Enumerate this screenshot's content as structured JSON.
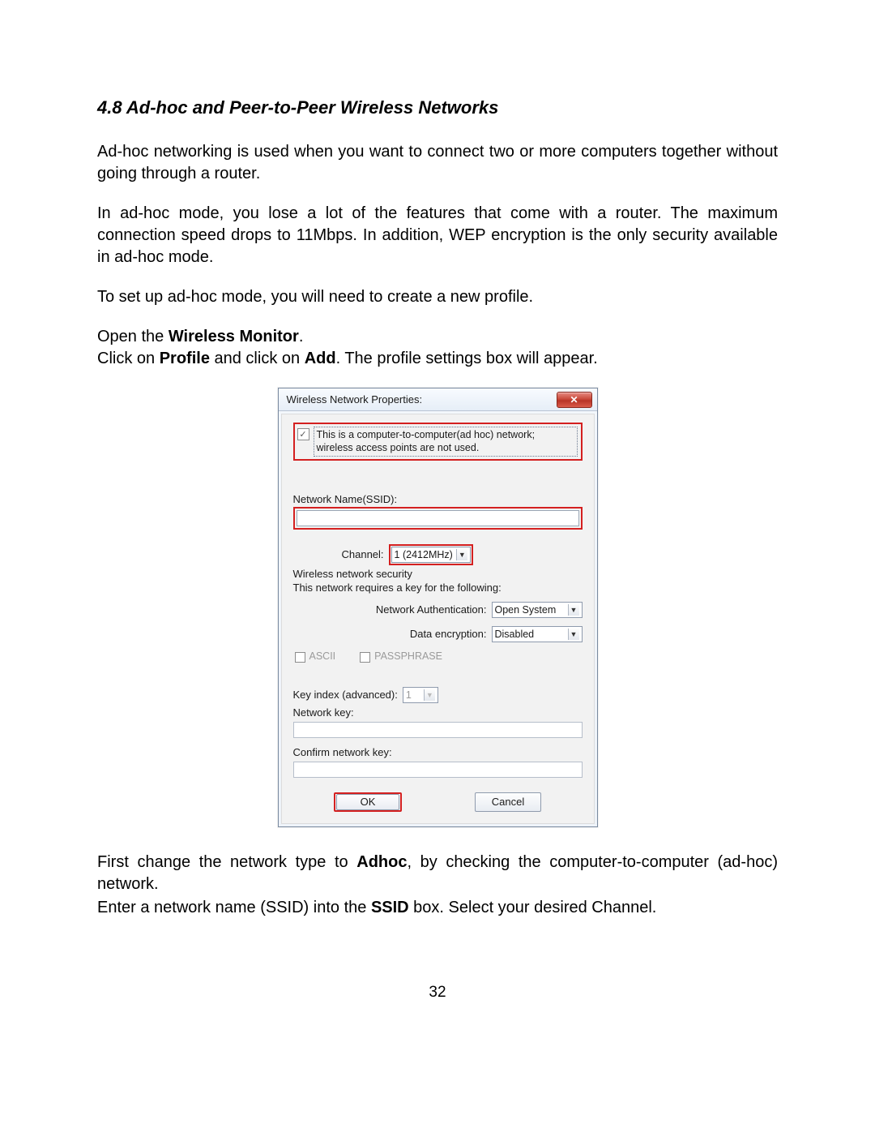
{
  "heading": "4.8 Ad-hoc and Peer-to-Peer Wireless Networks",
  "p1": "Ad-hoc networking is used when you want to connect two or more computers together without going through a router.",
  "p2": "In ad-hoc mode, you lose a lot of the features that come with a router. The maximum connection speed drops to 11Mbps. In addition, WEP encryption is the only security available in ad-hoc mode.",
  "p3": "To set up ad-hoc mode, you will need to create a new profile.",
  "open_prefix": "Open the ",
  "open_bold": "Wireless Monitor",
  "open_suffix": ".",
  "click_a": "Click on ",
  "click_b1": "Profile",
  "click_c": " and click on ",
  "click_b2": "Add",
  "click_d": ". The profile settings box will appear.",
  "dialog": {
    "title": "Wireless Network Properties:",
    "close_glyph": "✕",
    "adhoc_checked": "✓",
    "adhoc_text": "This is a computer-to-computer(ad hoc) network; wireless access points are not used.",
    "ssid_label": "Network Name(SSID):",
    "channel_label": "Channel:",
    "channel_value": "1  (2412MHz)",
    "sec_label": "Wireless network security",
    "sec_sub": "This network requires a key for the following:",
    "auth_label": "Network Authentication:",
    "auth_value": "Open System",
    "enc_label": "Data encryption:",
    "enc_value": "Disabled",
    "chk_ascii": "ASCII",
    "chk_pass": "PASSPHRASE",
    "keyidx_label": "Key index (advanced):",
    "keyidx_value": "1",
    "nk_label": "Network key:",
    "cnk_label": "Confirm network key:",
    "ok": "OK",
    "cancel": "Cancel",
    "dd_arrow": "▼"
  },
  "after1a": "First change the network type to ",
  "after1b": "Adhoc",
  "after1c": ", by checking the computer-to-computer (ad-hoc) network.",
  "after2a": "Enter a network name (SSID) into the ",
  "after2b": "SSID",
  "after2c": " box. Select your desired Channel.",
  "page_number": "32"
}
